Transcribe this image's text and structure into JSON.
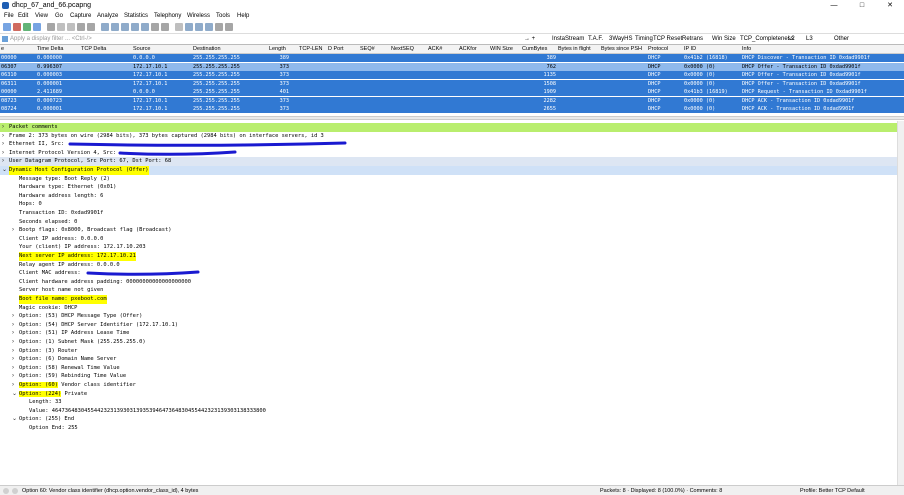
{
  "window": {
    "title": "dhcp_67_and_66.pcapng",
    "min": "—",
    "max": "□",
    "close": "✕"
  },
  "menu": [
    "File",
    "Edit",
    "View",
    "Go",
    "Capture",
    "Analyze",
    "Statistics",
    "Telephony",
    "Wireless",
    "Tools",
    "Help"
  ],
  "filter": {
    "placeholder": "Apply a display filter ... <Ctrl-/>",
    "buttons": [
      "InstaStream",
      "T.A.F.",
      "3WayHS",
      "Timing",
      "TCP Reset",
      "Retrans",
      "Win Size",
      "TCP_Completeness",
      "L2",
      "L3",
      "Other"
    ]
  },
  "packet_list": {
    "columns": [
      "e",
      "Time Delta",
      "TCP Delta",
      "Source",
      "Destination",
      "Length",
      "TCP-LEN",
      "D Port",
      "SEQ#",
      "NextSEQ",
      "ACK#",
      "ACKfor",
      "WIN Size",
      "CumBytes",
      "Bytes in flight",
      "Bytes since PSH",
      "Protocol",
      "IP ID",
      "Info"
    ],
    "rows": [
      {
        "no": "00000",
        "tdelta": "0.000000",
        "src": "0.0.0.0",
        "dst": "255.255.255.255",
        "len": "389",
        "cum": "389",
        "proto": "DHCP",
        "ipid": "0x41b2 (16818)",
        "info": "DHCP Discover - Transaction ID 0xdad9901f",
        "selected": false
      },
      {
        "no": "06307",
        "tdelta": "0.996307",
        "src": "172.17.10.1",
        "dst": "255.255.255.255",
        "len": "373",
        "cum": "762",
        "proto": "DHCP",
        "ipid": "0x0000 (0)",
        "info": "DHCP Offer    - Transaction ID 0xdad9901f",
        "selected": true
      },
      {
        "no": "06310",
        "tdelta": "0.000003",
        "src": "172.17.10.1",
        "dst": "255.255.255.255",
        "len": "373",
        "cum": "1135",
        "proto": "DHCP",
        "ipid": "0x0000 (0)",
        "info": "DHCP Offer    - Transaction ID 0xdad9901f",
        "selected": false
      },
      {
        "no": "06311",
        "tdelta": "0.000001",
        "src": "172.17.10.1",
        "dst": "255.255.255.255",
        "len": "373",
        "cum": "1508",
        "proto": "DHCP",
        "ipid": "0x0000 (0)",
        "info": "DHCP Offer    - Transaction ID 0xdad9901f",
        "selected": false
      },
      {
        "no": "00000",
        "tdelta": "2.411689",
        "src": "0.0.0.0",
        "dst": "255.255.255.255",
        "len": "401",
        "cum": "1909",
        "proto": "DHCP",
        "ipid": "0x41b3 (16819)",
        "info": "DHCP Request  - Transaction ID 0xdad9901f",
        "selected": false
      },
      {
        "no": "08723",
        "tdelta": "0.000723",
        "src": "172.17.10.1",
        "dst": "255.255.255.255",
        "len": "373",
        "cum": "2282",
        "proto": "DHCP",
        "ipid": "0x0000 (0)",
        "info": "DHCP ACK      - Transaction ID 0xdad9901f",
        "selected": false
      },
      {
        "no": "08724",
        "tdelta": "0.000001",
        "src": "172.17.10.1",
        "dst": "255.255.255.255",
        "len": "373",
        "cum": "2655",
        "proto": "DHCP",
        "ipid": "0x0000 (0)",
        "info": "DHCP ACK      - Transaction ID 0xdad9901f",
        "selected": false
      }
    ]
  },
  "details": [
    {
      "indent": 0,
      "arrow": ">",
      "text": "Packet comments",
      "style": "g"
    },
    {
      "indent": 0,
      "arrow": ">",
      "text": "Frame 2: 373 bytes on wire (2984 bits), 373 bytes captured (2984 bits) on interface servers, id 3",
      "style": ""
    },
    {
      "indent": 0,
      "arrow": ">",
      "text": "Ethernet II, Src:",
      "style": "",
      "redact": [
        70,
        345
      ]
    },
    {
      "indent": 0,
      "arrow": ">",
      "text": "Internet Protocol Version 4, Src:",
      "style": "",
      "redact": [
        120,
        235
      ]
    },
    {
      "indent": 0,
      "arrow": ">",
      "text": "User Datagram Protocol, Src Port: 67, Dst Port: 68",
      "style": "b"
    },
    {
      "indent": 0,
      "arrow": "v",
      "text": "Dynamic Host Configuration Protocol (Offer)",
      "style": "hl",
      "yellow": true
    },
    {
      "indent": 1,
      "arrow": "",
      "text": "Message type: Boot Reply (2)",
      "style": ""
    },
    {
      "indent": 1,
      "arrow": "",
      "text": "Hardware type: Ethernet (0x01)",
      "style": ""
    },
    {
      "indent": 1,
      "arrow": "",
      "text": "Hardware address length: 6",
      "style": ""
    },
    {
      "indent": 1,
      "arrow": "",
      "text": "Hops: 0",
      "style": ""
    },
    {
      "indent": 1,
      "arrow": "",
      "text": "Transaction ID: 0xdad9901f",
      "style": ""
    },
    {
      "indent": 1,
      "arrow": "",
      "text": "Seconds elapsed: 0",
      "style": ""
    },
    {
      "indent": 1,
      "arrow": ">",
      "text": "Bootp flags: 0x8000, Broadcast flag (Broadcast)",
      "style": ""
    },
    {
      "indent": 1,
      "arrow": "",
      "text": "Client IP address: 0.0.0.0",
      "style": ""
    },
    {
      "indent": 1,
      "arrow": "",
      "text": "Your (client) IP address: 172.17.10.203",
      "style": ""
    },
    {
      "indent": 1,
      "arrow": "",
      "text": "Next server IP address: 172.17.10.21",
      "style": "",
      "yellow": true
    },
    {
      "indent": 1,
      "arrow": "",
      "text": "Relay agent IP address: 0.0.0.0",
      "style": ""
    },
    {
      "indent": 1,
      "arrow": "",
      "text": "Client MAC address:",
      "style": "",
      "redact": [
        88,
        198
      ]
    },
    {
      "indent": 1,
      "arrow": "",
      "text": "Client hardware address padding: 00000000000000000000",
      "style": ""
    },
    {
      "indent": 1,
      "arrow": "",
      "text": "Server host name not given",
      "style": ""
    },
    {
      "indent": 1,
      "arrow": "",
      "text": "Boot file name: pxeboot.com",
      "style": "",
      "yellow": true
    },
    {
      "indent": 1,
      "arrow": "",
      "text": "Magic cookie: DHCP",
      "style": ""
    },
    {
      "indent": 1,
      "arrow": ">",
      "text": "Option: (53) DHCP Message Type (Offer)",
      "style": ""
    },
    {
      "indent": 1,
      "arrow": ">",
      "text": "Option: (54) DHCP Server Identifier (172.17.10.1)",
      "style": ""
    },
    {
      "indent": 1,
      "arrow": ">",
      "text": "Option: (51) IP Address Lease Time",
      "style": ""
    },
    {
      "indent": 1,
      "arrow": ">",
      "text": "Option: (1) Subnet Mask (255.255.255.0)",
      "style": ""
    },
    {
      "indent": 1,
      "arrow": ">",
      "text": "Option: (3) Router",
      "style": ""
    },
    {
      "indent": 1,
      "arrow": ">",
      "text": "Option: (6) Domain Name Server",
      "style": ""
    },
    {
      "indent": 1,
      "arrow": ">",
      "text": "Option: (58) Renewal Time Value",
      "style": ""
    },
    {
      "indent": 1,
      "arrow": ">",
      "text": "Option: (59) Rebinding Time Value",
      "style": ""
    },
    {
      "indent": 1,
      "arrow": ">",
      "text": "Option: (60) Vendor class identifier",
      "style": "",
      "yellowPart": "Option: (60)"
    },
    {
      "indent": 1,
      "arrow": "v",
      "text": "Option: (224) Private",
      "style": "",
      "yellowPart": "Option: (224)"
    },
    {
      "indent": 2,
      "arrow": "",
      "text": "Length: 33",
      "style": ""
    },
    {
      "indent": 2,
      "arrow": "",
      "text": "Value: 464736483045544232313930313935394647364830455442323139303138333800",
      "style": ""
    },
    {
      "indent": 1,
      "arrow": "v",
      "text": "Option: (255) End",
      "style": ""
    },
    {
      "indent": 2,
      "arrow": "",
      "text": "Option End: 255",
      "style": ""
    }
  ],
  "status": {
    "left": "Option 60: Vendor class identifier (dhcp.option.vendor_class_id), 4 bytes",
    "packets": "Packets: 8 · Displayed: 8 (100.0%) · Comments: 8",
    "profile": "Profile: Better TCP Default"
  },
  "colors": {
    "selected_row": "#8fb9ec",
    "row": "#3179d3",
    "highlight": "#ffff00",
    "comment_bg": "#b9ee6e",
    "redaction": "#1a1ad0"
  }
}
